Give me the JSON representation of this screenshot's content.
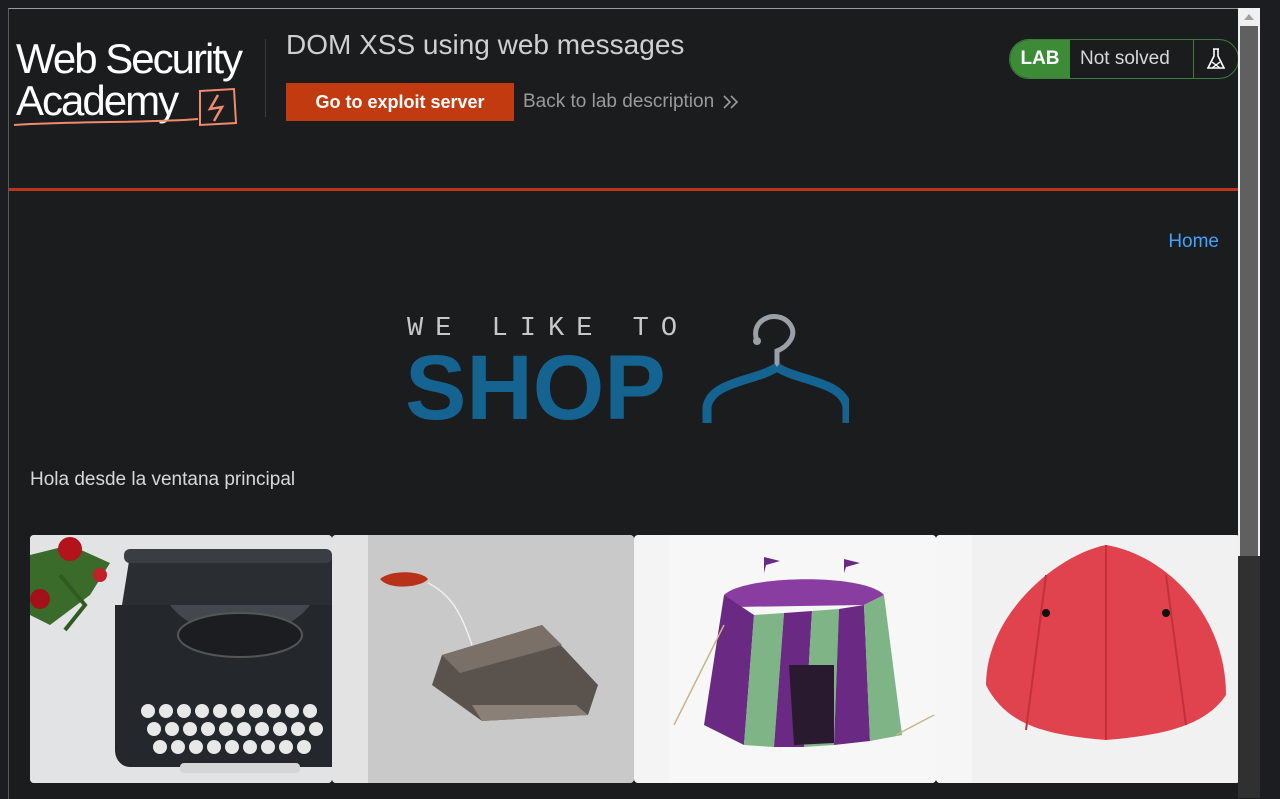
{
  "header": {
    "logo_line1": "Web Security",
    "logo_line2": "Academy",
    "lab_title": "DOM XSS using web messages",
    "exploit_button": "Go to exploit server",
    "back_link": "Back to lab description",
    "lab_badge": "LAB",
    "status": "Not solved"
  },
  "nav": {
    "home": "Home"
  },
  "shop_logo": {
    "tagline": "WE LIKE TO",
    "brand": "SHOP"
  },
  "message": "Hola desde la ventana principal",
  "colors": {
    "accent_orange": "#c23a10",
    "lab_green": "#3d8b37",
    "link_blue": "#3fa3ff",
    "shop_blue": "#156391"
  },
  "products": [
    {
      "image": "typewriter-image"
    },
    {
      "image": "tea-bag-image"
    },
    {
      "image": "tent-image"
    },
    {
      "image": "umbrella-image"
    }
  ]
}
